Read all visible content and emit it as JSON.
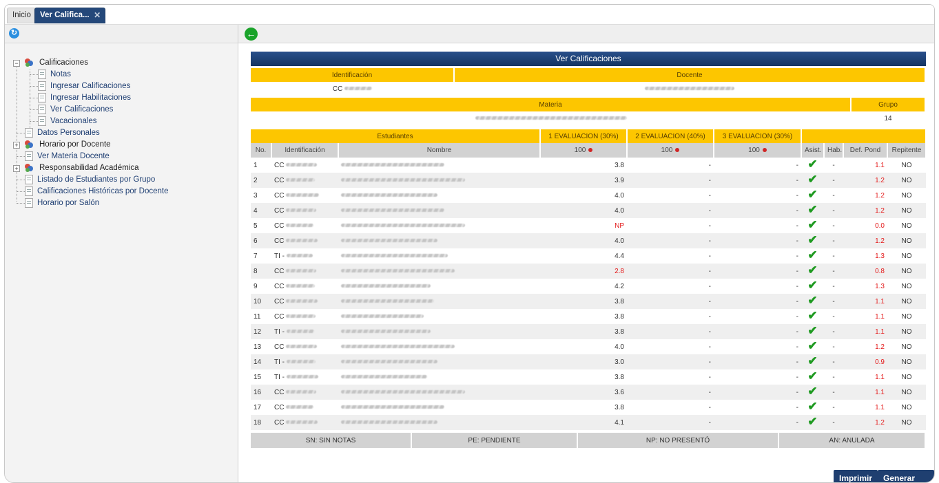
{
  "tabs": [
    {
      "label": "Inicio"
    },
    {
      "label": "Ver Califica..."
    }
  ],
  "tree": {
    "items": [
      {
        "label": "Calificaciones"
      },
      {
        "label": "Notas"
      },
      {
        "label": "Ingresar Calificaciones"
      },
      {
        "label": "Ingresar Habilitaciones"
      },
      {
        "label": "Ver Calificaciones"
      },
      {
        "label": "Vacacionales"
      },
      {
        "label": "Datos Personales"
      },
      {
        "label": "Horario por Docente"
      },
      {
        "label": "Ver Materia Docente"
      },
      {
        "label": "Responsabilidad Académica"
      },
      {
        "label": "Listado de Estudiantes por Grupo"
      },
      {
        "label": "Calificaciones Históricas por Docente"
      },
      {
        "label": "Horario por Salón"
      }
    ]
  },
  "report": {
    "title": "Ver Calificaciones",
    "identificacion_label": "Identificación",
    "docente_label": "Docente",
    "id_prefix": "CC",
    "materia_label": "Materia",
    "grupo_label": "Grupo",
    "grupo_value": "14",
    "estudiantes_label": "Estudiantes",
    "eval1": "1 EVALUACION (30%)",
    "eval2": "2 EVALUACION (40%)",
    "eval3": "3 EVALUACION (30%)",
    "cols": {
      "no": "No.",
      "identificacion": "Identificación",
      "nombre": "Nombre",
      "max1": "100",
      "max2": "100",
      "max3": "100",
      "asist": "Asist.",
      "hab": "Hab.",
      "def": "Def. Pond",
      "rep": "Repitente"
    },
    "rows": [
      {
        "no": "1",
        "tipo": "CC",
        "n1": "3.8",
        "n2": "-",
        "n3": "-",
        "hab": "-",
        "def": "1.1",
        "rep": "NO"
      },
      {
        "no": "2",
        "tipo": "CC",
        "n1": "3.9",
        "n2": "-",
        "n3": "-",
        "hab": "-",
        "def": "1.2",
        "rep": "NO"
      },
      {
        "no": "3",
        "tipo": "CC",
        "n1": "4.0",
        "n2": "-",
        "n3": "-",
        "hab": "-",
        "def": "1.2",
        "rep": "NO"
      },
      {
        "no": "4",
        "tipo": "CC",
        "n1": "4.0",
        "n2": "-",
        "n3": "-",
        "hab": "-",
        "def": "1.2",
        "rep": "NO"
      },
      {
        "no": "5",
        "tipo": "CC",
        "n1": "NP",
        "n2": "-",
        "n3": "-",
        "hab": "-",
        "def": "0.0",
        "rep": "NO"
      },
      {
        "no": "6",
        "tipo": "CC",
        "n1": "4.0",
        "n2": "-",
        "n3": "-",
        "hab": "-",
        "def": "1.2",
        "rep": "NO"
      },
      {
        "no": "7",
        "tipo": "TI -",
        "n1": "4.4",
        "n2": "-",
        "n3": "-",
        "hab": "-",
        "def": "1.3",
        "rep": "NO"
      },
      {
        "no": "8",
        "tipo": "CC",
        "n1": "2.8",
        "n2": "-",
        "n3": "-",
        "hab": "-",
        "def": "0.8",
        "rep": "NO"
      },
      {
        "no": "9",
        "tipo": "CC",
        "n1": "4.2",
        "n2": "-",
        "n3": "-",
        "hab": "-",
        "def": "1.3",
        "rep": "NO"
      },
      {
        "no": "10",
        "tipo": "CC",
        "n1": "3.8",
        "n2": "-",
        "n3": "-",
        "hab": "-",
        "def": "1.1",
        "rep": "NO"
      },
      {
        "no": "11",
        "tipo": "CC",
        "n1": "3.8",
        "n2": "-",
        "n3": "-",
        "hab": "-",
        "def": "1.1",
        "rep": "NO"
      },
      {
        "no": "12",
        "tipo": "TI -",
        "n1": "3.8",
        "n2": "-",
        "n3": "-",
        "hab": "-",
        "def": "1.1",
        "rep": "NO"
      },
      {
        "no": "13",
        "tipo": "CC",
        "n1": "4.0",
        "n2": "-",
        "n3": "-",
        "hab": "-",
        "def": "1.2",
        "rep": "NO"
      },
      {
        "no": "14",
        "tipo": "TI -",
        "n1": "3.0",
        "n2": "-",
        "n3": "-",
        "hab": "-",
        "def": "0.9",
        "rep": "NO"
      },
      {
        "no": "15",
        "tipo": "TI -",
        "n1": "3.8",
        "n2": "-",
        "n3": "-",
        "hab": "-",
        "def": "1.1",
        "rep": "NO"
      },
      {
        "no": "16",
        "tipo": "CC",
        "n1": "3.6",
        "n2": "-",
        "n3": "-",
        "hab": "-",
        "def": "1.1",
        "rep": "NO"
      },
      {
        "no": "17",
        "tipo": "CC",
        "n1": "3.8",
        "n2": "-",
        "n3": "-",
        "hab": "-",
        "def": "1.1",
        "rep": "NO"
      },
      {
        "no": "18",
        "tipo": "CC",
        "n1": "4.1",
        "n2": "-",
        "n3": "-",
        "hab": "-",
        "def": "1.2",
        "rep": "NO"
      }
    ],
    "legend": [
      "SN: SIN NOTAS",
      "PE: PENDIENTE",
      "NP: NO PRESENTÓ",
      "AN: ANULADA"
    ],
    "print_label": "Imprimir",
    "xls_label": "Generar XLS"
  },
  "colors": {
    "header_yellow": "#fdc600",
    "title_blue": "#153562",
    "low_grade_red": "#e41b1b",
    "check_green": "#1f9a21"
  }
}
